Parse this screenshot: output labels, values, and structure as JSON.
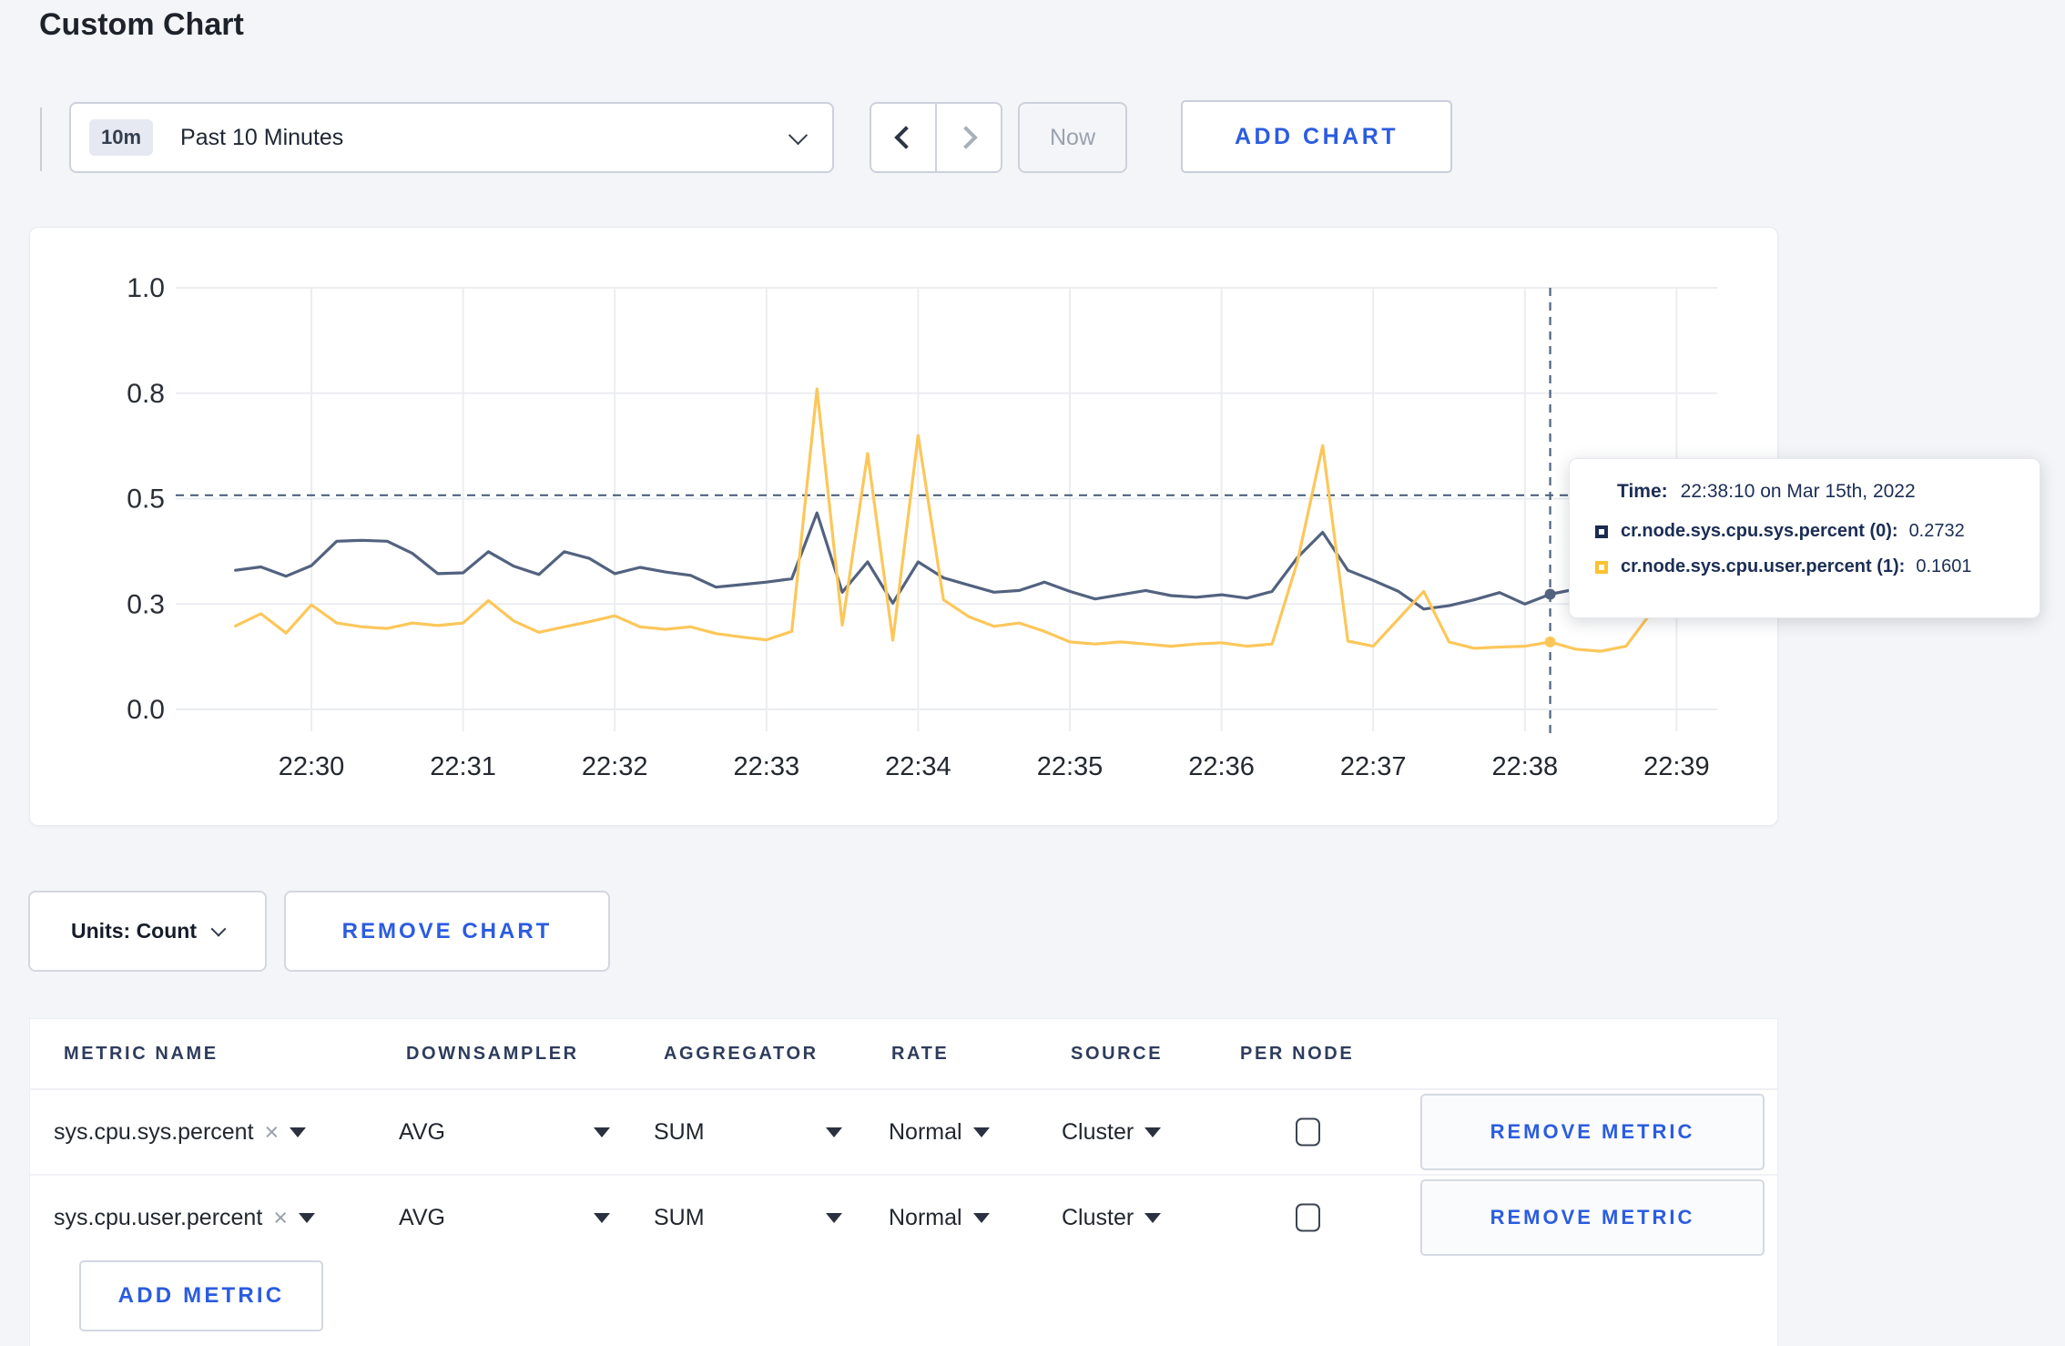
{
  "page": {
    "title": "Custom Chart"
  },
  "colors": {
    "accent_blue": "#2b5ce0",
    "series_sys": "#52627f",
    "series_user": "#fcc75a",
    "tooltip_swatch_sys": "#1b2b50",
    "tooltip_swatch_user": "#fcc12e",
    "page_background": "#f4f5f8"
  },
  "time_selector": {
    "badge": "10m",
    "label": "Past 10 Minutes"
  },
  "nav": {
    "now_label": "Now"
  },
  "add_chart_label": "ADD CHART",
  "units_label": "Units: Count",
  "remove_chart_label": "REMOVE CHART",
  "tooltip": {
    "time_key": "Time:",
    "time_value": "22:38:10 on Mar 15th, 2022",
    "rows": [
      {
        "name": "cr.node.sys.cpu.sys.percent (0):",
        "value": "0.2732"
      },
      {
        "name": "cr.node.sys.cpu.user.percent (1):",
        "value": "0.1601"
      }
    ]
  },
  "chart_data": {
    "type": "line",
    "title": "",
    "xlabel": "",
    "ylabel": "",
    "ylim": [
      0,
      1.0
    ],
    "grid": true,
    "y_ticks": [
      {
        "label": "1.0",
        "value": 1.0
      },
      {
        "label": "0.8",
        "value": 0.75
      },
      {
        "label": "0.5",
        "value": 0.5
      },
      {
        "label": "0.3",
        "value": 0.25
      },
      {
        "label": "0.0",
        "value": 0.0
      }
    ],
    "x_ticks": [
      "22:30",
      "22:31",
      "22:32",
      "22:33",
      "22:34",
      "22:35",
      "22:36",
      "22:37",
      "22:38",
      "22:39"
    ],
    "start": "22:29:30",
    "interval_s": 10,
    "crosshair": {
      "time": "22:38:10",
      "hover_value": 0.508,
      "index": 52
    },
    "series": [
      {
        "name": "cr.node.sys.cpu.sys.percent",
        "color": "#52627f",
        "values": [
          0.33,
          0.338,
          0.316,
          0.341,
          0.399,
          0.401,
          0.399,
          0.37,
          0.322,
          0.324,
          0.374,
          0.34,
          0.32,
          0.374,
          0.358,
          0.322,
          0.337,
          0.326,
          0.318,
          0.29,
          0.296,
          0.302,
          0.31,
          0.466,
          0.278,
          0.35,
          0.252,
          0.35,
          0.312,
          0.295,
          0.278,
          0.282,
          0.302,
          0.28,
          0.262,
          0.272,
          0.282,
          0.27,
          0.266,
          0.272,
          0.264,
          0.28,
          0.36,
          0.42,
          0.33,
          0.306,
          0.28,
          0.238,
          0.246,
          0.26,
          0.277,
          0.25,
          0.2732,
          0.285,
          0.3,
          0.295,
          0.29,
          0.3,
          0.31
        ]
      },
      {
        "name": "cr.node.sys.cpu.user.percent",
        "color": "#fcc75a",
        "values": [
          0.198,
          0.227,
          0.181,
          0.248,
          0.205,
          0.196,
          0.192,
          0.205,
          0.199,
          0.205,
          0.258,
          0.21,
          0.183,
          0.196,
          0.208,
          0.222,
          0.196,
          0.19,
          0.196,
          0.18,
          0.172,
          0.165,
          0.185,
          0.76,
          0.2,
          0.607,
          0.164,
          0.65,
          0.26,
          0.22,
          0.197,
          0.205,
          0.185,
          0.16,
          0.155,
          0.16,
          0.155,
          0.15,
          0.155,
          0.158,
          0.15,
          0.155,
          0.35,
          0.626,
          0.162,
          0.15,
          0.215,
          0.28,
          0.16,
          0.145,
          0.148,
          0.15,
          0.1601,
          0.143,
          0.138,
          0.15,
          0.23,
          0.28,
          0.28
        ]
      }
    ]
  },
  "metrics": {
    "headers": [
      "METRIC NAME",
      "DOWNSAMPLER",
      "AGGREGATOR",
      "RATE",
      "SOURCE",
      "PER NODE"
    ],
    "rows": [
      {
        "name": "sys.cpu.sys.percent",
        "remove_glyph": "×",
        "downsampler": "AVG",
        "aggregator": "SUM",
        "rate": "Normal",
        "source": "Cluster",
        "per_node_checked": false,
        "remove_label": "REMOVE METRIC"
      },
      {
        "name": "sys.cpu.user.percent",
        "remove_glyph": "×",
        "downsampler": "AVG",
        "aggregator": "SUM",
        "rate": "Normal",
        "source": "Cluster",
        "per_node_checked": false,
        "remove_label": "REMOVE METRIC"
      }
    ],
    "add_metric_label": "ADD METRIC"
  }
}
